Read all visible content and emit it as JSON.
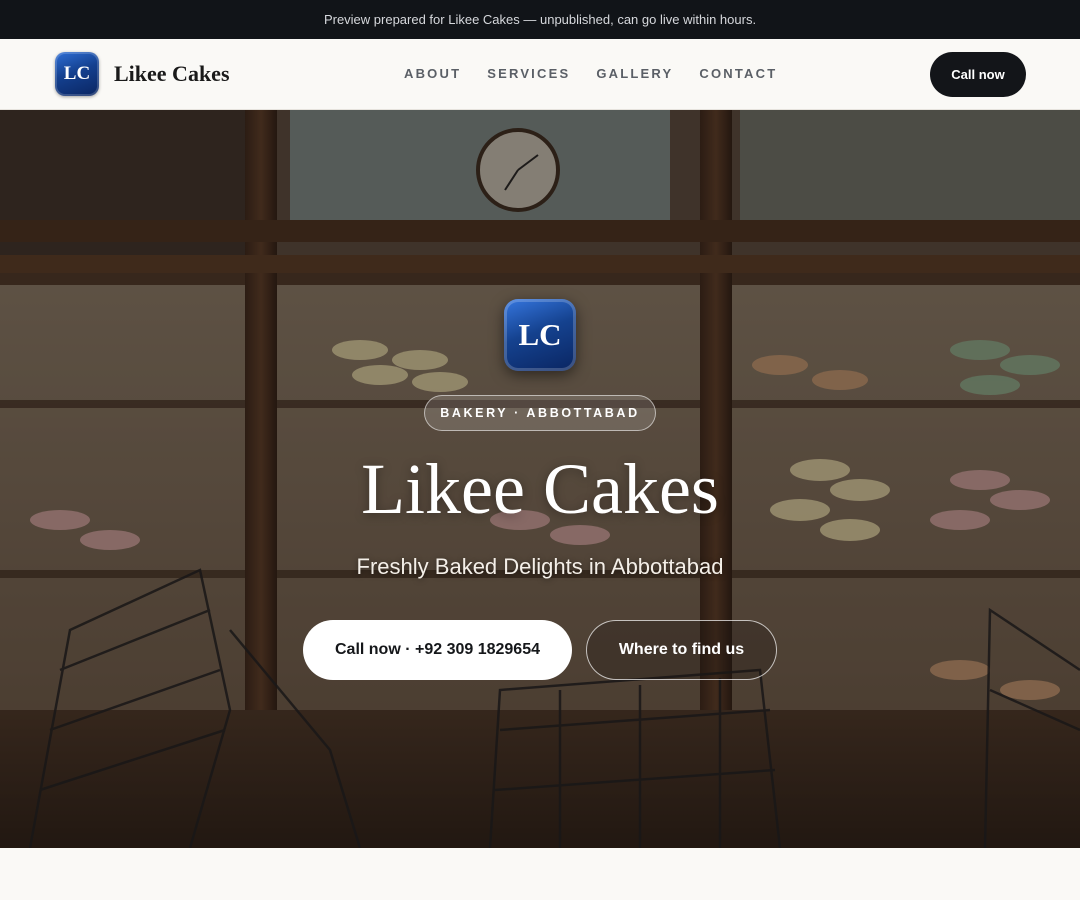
{
  "preview_bar": {
    "text": "Preview prepared for Likee Cakes — unpublished, can go live within hours."
  },
  "header": {
    "logo_initials": "LC",
    "brand_name": "Likee Cakes",
    "nav": [
      {
        "label": "ABOUT"
      },
      {
        "label": "SERVICES"
      },
      {
        "label": "GALLERY"
      },
      {
        "label": "CONTACT"
      }
    ],
    "cta_label": "Call now"
  },
  "hero": {
    "logo_initials": "LC",
    "eyebrow": "BAKERY · ABBOTTABAD",
    "title": "Likee Cakes",
    "subtitle": "Freshly Baked Delights in Abbottabad",
    "primary_button": "Call now · +92 309 1829654",
    "secondary_button": "Where to find us"
  },
  "colors": {
    "preview_bar_bg": "#111418",
    "header_cta_bg": "#131519",
    "brand_blue": "#14408f",
    "page_bg": "#faf9f6"
  }
}
